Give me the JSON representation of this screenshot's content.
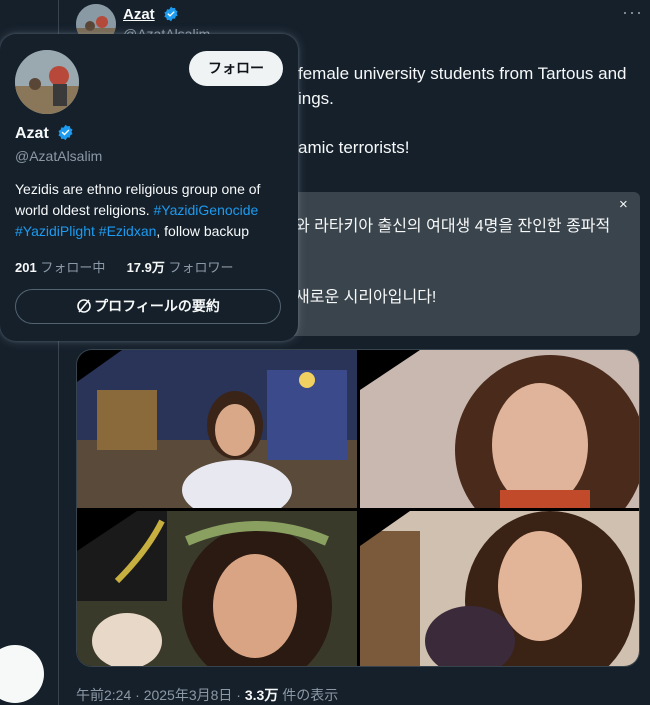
{
  "tweet": {
    "author_name": "Azat",
    "author_handle": "@AzatAlsalim",
    "more_label": "···",
    "text_line1": "female university students from Tartous and",
    "text_line2": "ings.",
    "text_line3": "amic terrorists!",
    "quote_line1": "와 라타키아 출신의 여대생 4명을 잔인한 종파적",
    "quote_line2": "새로운 시리아입니다!",
    "quote_close": "×",
    "meta_time": "午前2:24 · 2025年3月8日 · ",
    "meta_views": "3.3万",
    "meta_views_suffix": " 件の表示"
  },
  "hovercard": {
    "follow_label": "フォロー",
    "name": "Azat",
    "handle": "@AzatAlsalim",
    "bio_text1": "Yezidis are ethno religious group one of world oldest religions. ",
    "bio_tag1": "#YazidiGenocide",
    "bio_tag2": "#YazidiPlight",
    "bio_tag3": "#Ezidxan",
    "bio_text2": ", follow backup",
    "following_count": "201",
    "following_label": " フォロー中",
    "followers_count": "17.9万",
    "followers_label": " フォロワー",
    "summary_label": "プロフィールの要約"
  },
  "colors": {
    "background": "#15202b",
    "link": "#1d9bf0",
    "verified": "#1d9bf0",
    "quote_bg": "#3a444c"
  },
  "icons": [
    "verified-badge-icon",
    "more-icon",
    "close-icon",
    "grok-slash-icon"
  ]
}
